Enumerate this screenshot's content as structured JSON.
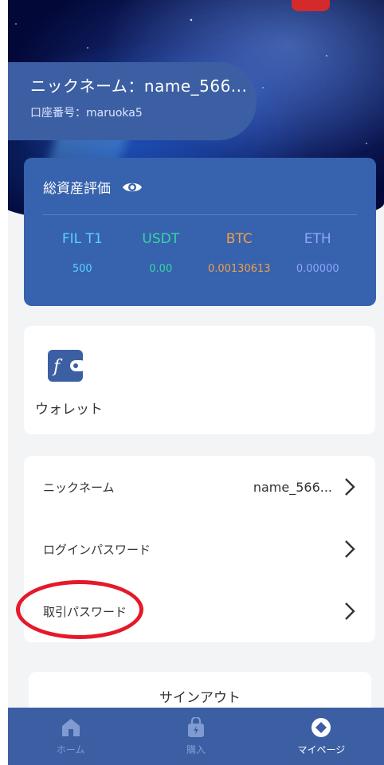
{
  "profile": {
    "nickname_line": "ニックネーム：name_566...",
    "account_line": "口座番号：maruoka5"
  },
  "assets": {
    "title": "総資産評価",
    "icon": "eye-icon",
    "columns": [
      {
        "label": "FIL T1",
        "value": "500",
        "color": "#5ad1ff"
      },
      {
        "label": "USDT",
        "value": "0.00",
        "color": "#36d6a6"
      },
      {
        "label": "BTC",
        "value": "0.00130613",
        "color": "#f0a04a"
      },
      {
        "label": "ETH",
        "value": "0.00000",
        "color": "#8ea6ff"
      }
    ]
  },
  "wallet": {
    "label": "ウォレット",
    "icon": "wallet-icon"
  },
  "settings": {
    "rows": [
      {
        "label": "ニックネーム",
        "value": "name_566..."
      },
      {
        "label": "ログインパスワード",
        "value": ""
      },
      {
        "label": "取引パスワード",
        "value": ""
      }
    ]
  },
  "signout": {
    "label": "サインアウト"
  },
  "nav": {
    "items": [
      {
        "label": "ホーム",
        "icon": "home-icon",
        "active": false
      },
      {
        "label": "購入",
        "icon": "purchase-icon",
        "active": false
      },
      {
        "label": "マイページ",
        "icon": "mypage-icon",
        "active": true
      }
    ]
  },
  "colors": {
    "primary": "#3c5fa3",
    "asset_card": "#3762ad",
    "annotation": "#e5192a"
  }
}
